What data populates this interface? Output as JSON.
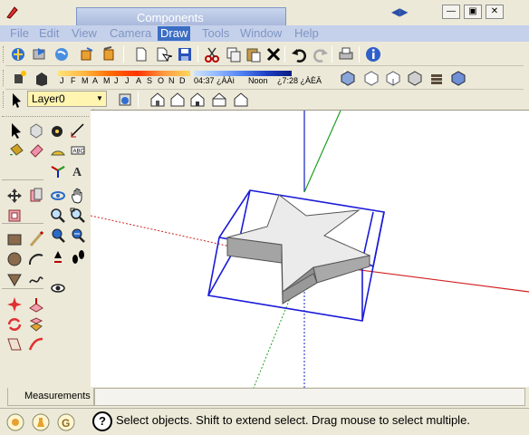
{
  "window": {
    "panel_title": "Components"
  },
  "menu": [
    {
      "label": "File"
    },
    {
      "label": "Edit"
    },
    {
      "label": "View"
    },
    {
      "label": "Camera"
    },
    {
      "label": "Draw"
    },
    {
      "label": "Tools"
    },
    {
      "label": "Window"
    },
    {
      "label": "Help"
    }
  ],
  "shadow": {
    "months": [
      "J",
      "F",
      "M",
      "A",
      "M",
      "J",
      "J",
      "A",
      "S",
      "O",
      "N",
      "D"
    ],
    "time_start": "04:37 ¿ÀÀì",
    "time_mid": "Noon",
    "time_end": "¿7:28 ¿ÀÈÄ"
  },
  "layer": {
    "current": "Layer0"
  },
  "measurements": {
    "label": "Measurements",
    "value": ""
  },
  "status": {
    "text": "Select objects. Shift to extend select. Drag mouse to select multiple."
  },
  "colors": {
    "axis_red": "#d02020",
    "axis_green": "#20a020",
    "axis_blue": "#1020c0",
    "selection": "#1a1ad8"
  }
}
